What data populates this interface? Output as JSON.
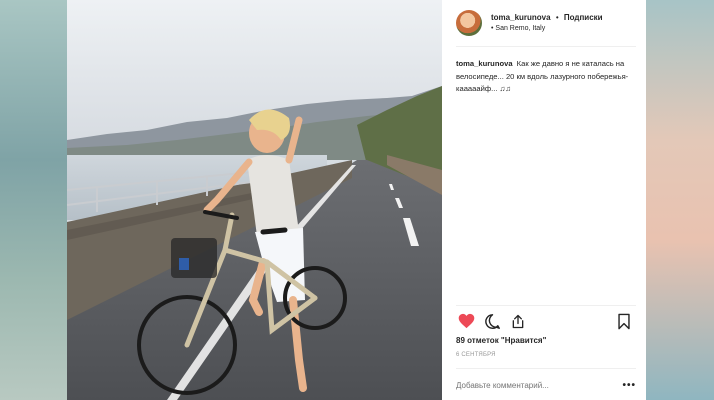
{
  "post": {
    "username": "toma_kurunova",
    "separator": "•",
    "follow_label": "Подписки",
    "location_prefix": "•",
    "location": "San Remo, Italy",
    "caption_username": "toma_kurunova",
    "caption_text": "Как же давно я не каталась на велосипеде... 20 км вдоль лазурного побережья-кааааайф... ♫♫",
    "likes": "89 отметок \"Нравится\"",
    "date": "6 СЕНТЯБРЯ",
    "comment_placeholder": "Добавьте комментарий...",
    "more_label": "•••",
    "liked": true
  },
  "icons": {
    "like": "heart-filled-icon",
    "comment": "comment-icon",
    "share": "share-icon",
    "save": "bookmark-icon",
    "more": "more-options-icon"
  },
  "colors": {
    "heart": "#ed4956",
    "text": "#262626",
    "muted": "#999999"
  }
}
